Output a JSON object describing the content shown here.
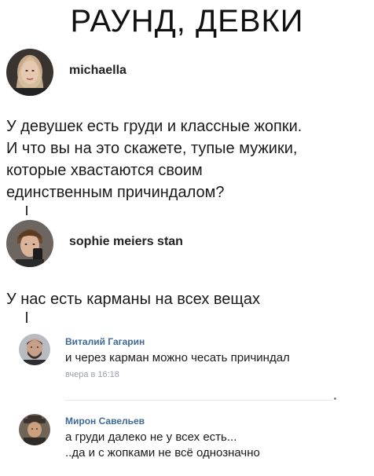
{
  "headline": "РАУНД, ДЕВКИ",
  "post1": {
    "username": "michaella",
    "avatar_icon": "woman-portrait-avatar",
    "lines": [
      "У девушек есть груди и классные жопки.",
      "И что вы на это скажете, тупые мужики,",
      "которые хвастаются своим",
      "единственным причиндалом?"
    ]
  },
  "post2": {
    "username": "sophie meiers stan",
    "avatar_icon": "man-selfie-avatar",
    "lines": [
      "У нас есть карманы на всех вещах"
    ]
  },
  "comments": [
    {
      "name": "Виталий Гагарин",
      "avatar_icon": "bearded-man-avatar",
      "lines": [
        "и через карман можно чесать причиндал"
      ],
      "time": "вчера в 16:18"
    },
    {
      "name": "Мирон Савельев",
      "avatar_icon": "man-in-hat-avatar",
      "lines": [
        "а груди далеко не у всех есть...",
        "..да и с жопками не всё однозначно"
      ]
    }
  ]
}
